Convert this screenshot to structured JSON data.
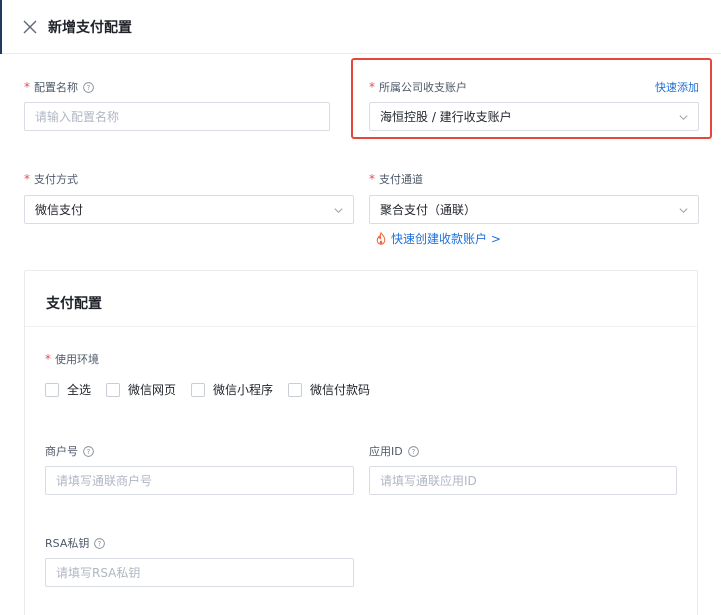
{
  "header": {
    "title": "新增支付配置"
  },
  "form": {
    "config_name": {
      "label": "配置名称",
      "placeholder": "请输入配置名称"
    },
    "company_account": {
      "label": "所属公司收支账户",
      "quick_add": "快速添加",
      "value": "海恒控股 / 建行收支账户"
    },
    "pay_method": {
      "label": "支付方式",
      "value": "微信支付"
    },
    "pay_channel": {
      "label": "支付通道",
      "value": "聚合支付（通联）",
      "quick_create": "快速创建收款账户 >"
    }
  },
  "payment_config": {
    "title": "支付配置",
    "env": {
      "label": "使用环境",
      "options": [
        "全选",
        "微信网页",
        "微信小程序",
        "微信付款码"
      ]
    },
    "merchant_no": {
      "label": "商户号",
      "placeholder": "请填写通联商户号"
    },
    "app_id": {
      "label": "应用ID",
      "placeholder": "请填写通联应用ID"
    },
    "rsa_key": {
      "label": "RSA私钥",
      "placeholder": "请填写RSA私钥"
    }
  },
  "colors": {
    "required": "#e34d59",
    "link": "#1e6fd9",
    "highlight": "#e5483b"
  }
}
